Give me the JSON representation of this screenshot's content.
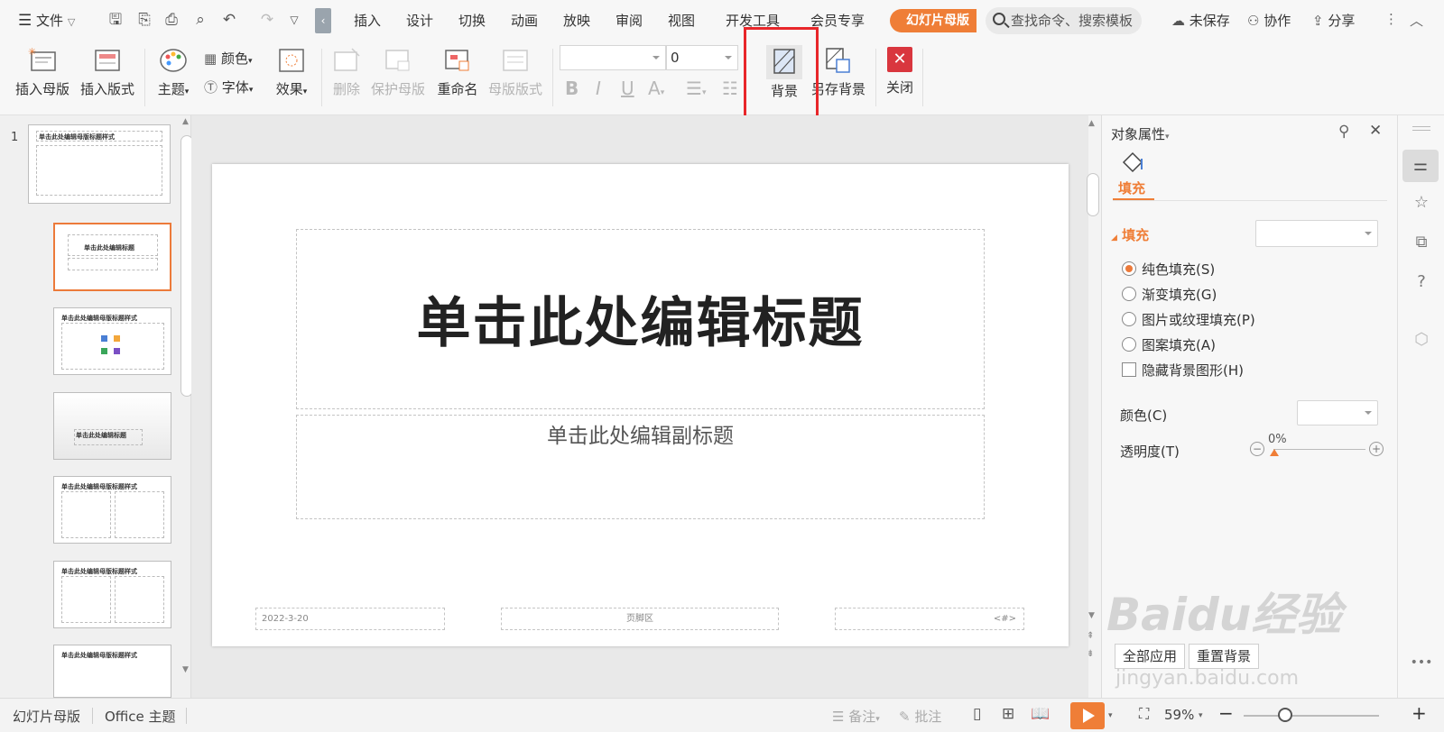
{
  "menubar": {
    "file_label": "文件",
    "tabs": [
      "插入",
      "设计",
      "切换",
      "动画",
      "放映",
      "审阅",
      "视图",
      "开发工具",
      "会员专享"
    ],
    "active_tab": "幻灯片母版",
    "search_placeholder": "查找命令、搜索模板",
    "unsaved_label": "未保存",
    "collab_label": "协作",
    "share_label": "分享"
  },
  "ribbon": {
    "insert_master": "插入母版",
    "insert_layout": "插入版式",
    "theme": "主题",
    "colors": "颜色",
    "fonts": "字体",
    "effects": "效果",
    "delete": "删除",
    "protect_master": "保护母版",
    "rename": "重命名",
    "master_layout": "母版版式",
    "font_size_value": "0",
    "background": "背景",
    "save_background": "另存背景",
    "close": "关闭"
  },
  "thumbnails": {
    "slide_number": "1",
    "master_title": "单击此处编辑母版标题样式",
    "layout_title": "单击此处编辑标题"
  },
  "slide": {
    "title": "单击此处编辑标题",
    "subtitle": "单击此处编辑副标题",
    "date": "2022-3-20",
    "footer": "页脚区",
    "slide_number_placeholder": "<#>"
  },
  "properties": {
    "panel_title": "对象属性",
    "tab_fill": "填充",
    "section_fill": "填充",
    "fill_options": [
      "纯色填充(S)",
      "渐变填充(G)",
      "图片或纹理填充(P)",
      "图案填充(A)"
    ],
    "hide_bg_shapes": "隐藏背景图形(H)",
    "color_label": "颜色(C)",
    "transparency_label": "透明度(T)",
    "transparency_value": "0%",
    "apply_all": "全部应用",
    "reset_bg": "重置背景"
  },
  "statusbar": {
    "mode": "幻灯片母版",
    "theme": "Office 主题",
    "notes": "备注",
    "comments": "批注",
    "zoom": "59%"
  },
  "watermark": {
    "brand": "Baidu经验",
    "url": "jingyan.baidu.com"
  },
  "colors": {
    "accent": "#ef7e37",
    "highlight": "#e8262a",
    "close_red": "#d9363e"
  }
}
